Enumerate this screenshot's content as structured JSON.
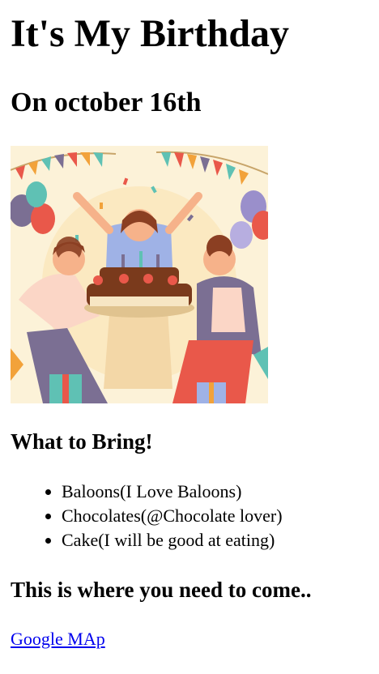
{
  "heading": "It's My Birthday",
  "subheading": "On october 16th",
  "image": {
    "alt": "Birthday party illustration",
    "colors": {
      "background": "#fcf2d8",
      "cake": "#7a3a1c",
      "accent_red": "#e9584a",
      "accent_teal": "#5fc1b4",
      "accent_purple": "#7b6f93"
    }
  },
  "bring": {
    "title": "What to Bring!",
    "items": [
      "Baloons(I Love Baloons)",
      "Chocolates(@Chocolate lover)",
      "Cake(I will be good at eating)"
    ]
  },
  "location": {
    "title": "This is where you need to come..",
    "link_text": "Google MAp",
    "link_color": "#0000ee"
  }
}
